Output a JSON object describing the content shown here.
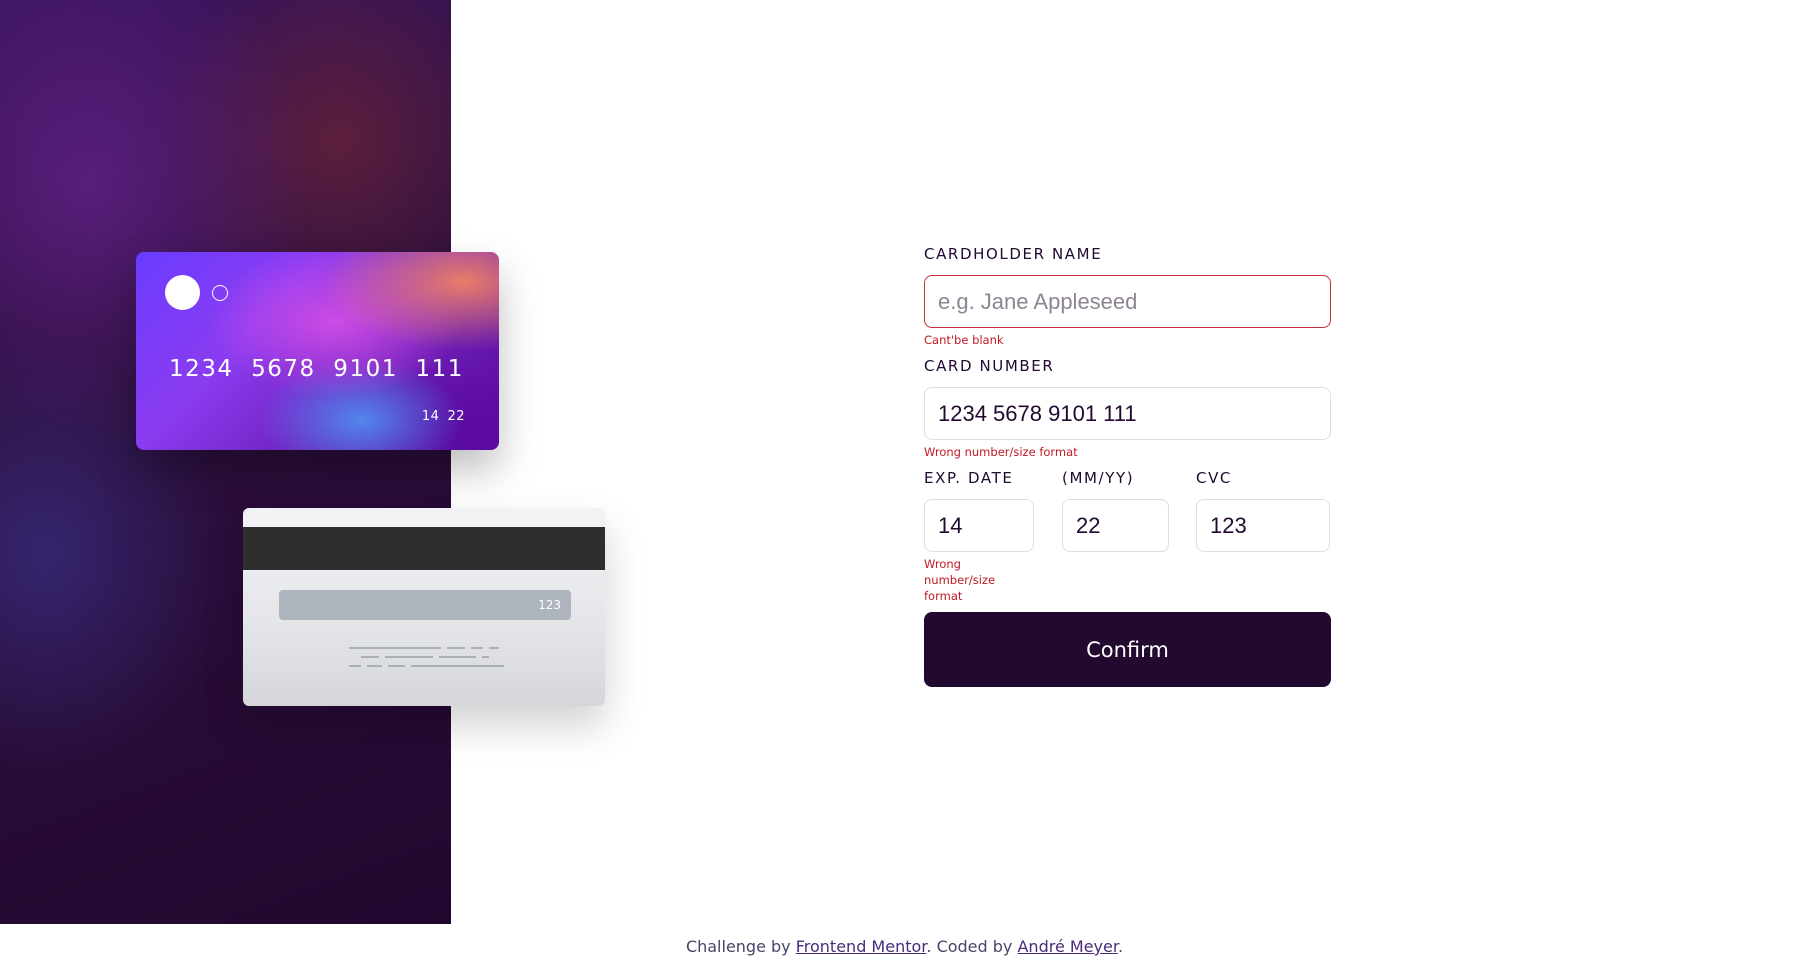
{
  "card_front": {
    "number": "1234  5678  9101  111",
    "exp_month": "14",
    "exp_year": "22"
  },
  "card_back": {
    "cvc": "123"
  },
  "form": {
    "name": {
      "label": "Cardholder Name",
      "placeholder": "e.g. Jane Appleseed",
      "value": "",
      "error": "Cant'be blank"
    },
    "number": {
      "label": "Card Number",
      "value": "1234 5678 9101 111",
      "error": "Wrong number/size format"
    },
    "exp_label": "Exp. Date",
    "exp_sub_label": "(MM/YY)",
    "exp_month": {
      "value": "14",
      "error": "Wrong number/size format"
    },
    "exp_year": {
      "value": "22"
    },
    "cvc": {
      "label": "CVC",
      "value": "123"
    },
    "confirm_label": "Confirm"
  },
  "footer": {
    "prefix": "Challenge by ",
    "link1": "Frontend Mentor",
    "middle": ". Coded by ",
    "link2": "André Meyer",
    "suffix": "."
  },
  "colors": {
    "dark_violet": "#21092f",
    "error_red": "#cc2d38",
    "input_border": "#dedddf"
  }
}
